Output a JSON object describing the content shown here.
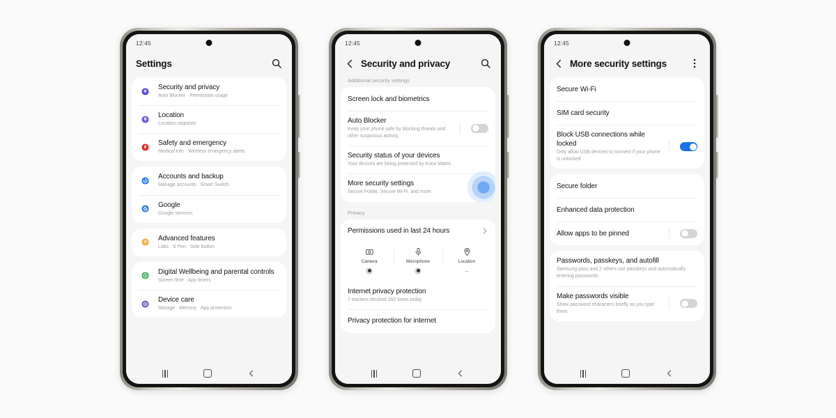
{
  "background_color": "#fafafa",
  "accent_blue": "#1a73e8",
  "phones": [
    {
      "id": "phone-settings",
      "statusbar": {
        "time": "12:45"
      },
      "appbar": {
        "title": "Settings",
        "has_back": false,
        "action_icon": "search-icon"
      },
      "section_label": "",
      "cards": [
        {
          "rows": [
            {
              "type": "icon-row",
              "icon": "shield-icon",
              "icon_color": "#5a4ae3",
              "title": "Security and privacy",
              "subtitle": "Auto Blocker  ·  Permission usage"
            },
            {
              "type": "icon-row",
              "icon": "location-pin-icon",
              "icon_color": "#6b5ce7",
              "title": "Location",
              "subtitle": "Location requests"
            },
            {
              "type": "icon-row",
              "icon": "safety-icon",
              "icon_color": "#e02f2f",
              "title": "Safety and emergency",
              "subtitle": "Medical info  ·  Wireless emergency alerts"
            }
          ]
        },
        {
          "rows": [
            {
              "type": "icon-row",
              "icon": "sync-accounts-icon",
              "icon_color": "#1a73e8",
              "title": "Accounts and backup",
              "subtitle": "Manage accounts  ·  Smart Switch"
            },
            {
              "type": "icon-row",
              "icon": "google-g-icon",
              "icon_color": "#2b7de9",
              "title": "Google",
              "subtitle": "Google services"
            }
          ]
        },
        {
          "rows": [
            {
              "type": "icon-row",
              "icon": "gear-star-icon",
              "icon_color": "#f5ab3d",
              "title": "Advanced features",
              "subtitle": "Labs  ·  S Pen  ·  Side button"
            }
          ]
        },
        {
          "rows": [
            {
              "type": "icon-row",
              "icon": "wellbeing-icon",
              "icon_color": "#34a853",
              "title": "Digital Wellbeing and parental controls",
              "subtitle": "Screen time   ·  App timers"
            },
            {
              "type": "icon-row",
              "icon": "device-care-icon",
              "icon_color": "#5f52b8",
              "title": "Device care",
              "subtitle": "Storage  ·  Memory  ·  App protection"
            }
          ]
        }
      ],
      "navbar": {
        "recents": "recents-icon",
        "home": "home-icon",
        "back": "back-icon"
      }
    },
    {
      "id": "phone-security-privacy",
      "statusbar": {
        "time": "12:45"
      },
      "appbar": {
        "title": "Security and privacy",
        "has_back": true,
        "action_icon": "search-icon"
      },
      "section_label": "Additional security settings",
      "cards": [
        {
          "rows": [
            {
              "type": "plain",
              "title": "Screen lock and biometrics"
            },
            {
              "type": "toggle",
              "title": "Auto Blocker",
              "subtitle": "Keep your phone safe by blocking threats and other suspicious activity.",
              "toggle_on": false
            },
            {
              "type": "plain",
              "title": "Security status of your devices",
              "subtitle": "Your devices are being protected by Knox Matrix."
            },
            {
              "type": "plain",
              "title": "More security settings",
              "subtitle": "Secure Folder, Secure Wi-Fi, and more.",
              "ripple": true
            }
          ]
        }
      ],
      "section_label_2": "Privacy",
      "cards_2": [
        {
          "rows": [
            {
              "type": "chevron",
              "title": "Permissions used in last 24 hours"
            }
          ],
          "permissions": [
            {
              "icon": "camera-icon",
              "label": "Camera",
              "state": "dot"
            },
            {
              "icon": "microphone-icon",
              "label": "Microphone",
              "state": "dot"
            },
            {
              "icon": "location-icon",
              "label": "Location",
              "state": "dash"
            }
          ],
          "rows_after": [
            {
              "type": "plain",
              "title": "Internet privacy protection",
              "subtitle": "7 trackers blocked 392 times today"
            },
            {
              "type": "plain",
              "title": "Privacy protection for internet"
            }
          ]
        }
      ],
      "navbar": {
        "recents": "recents-icon",
        "home": "home-icon",
        "back": "back-icon"
      }
    },
    {
      "id": "phone-more-security",
      "statusbar": {
        "time": "12:45"
      },
      "appbar": {
        "title": "More security settings",
        "has_back": true,
        "action_icon": "kebab-menu-icon"
      },
      "section_label": "",
      "cards": [
        {
          "rows": [
            {
              "type": "plain",
              "title": "Secure Wi-Fi"
            },
            {
              "type": "plain",
              "title": "SIM card security"
            },
            {
              "type": "toggle",
              "title": "Block USB connections while locked",
              "subtitle": "Only allow USB devices to connect if your phone is unlocked",
              "toggle_on": true
            }
          ]
        },
        {
          "rows": [
            {
              "type": "plain",
              "title": "Secure folder"
            },
            {
              "type": "plain",
              "title": "Enhanced data protection"
            },
            {
              "type": "toggle",
              "title": "Allow apps to be pinned",
              "toggle_on": false
            }
          ]
        },
        {
          "rows": [
            {
              "type": "plain",
              "title": "Passwords, passkeys, and autofill",
              "subtitle": "Samsung pass and 2 others use passkeys and automatically entering passwords"
            },
            {
              "type": "toggle",
              "title": "Make passwords visible",
              "subtitle": "Show password characters briefly as you type them.",
              "toggle_on": false
            }
          ]
        }
      ],
      "navbar": {
        "recents": "recents-icon",
        "home": "home-icon",
        "back": "back-icon"
      }
    }
  ]
}
